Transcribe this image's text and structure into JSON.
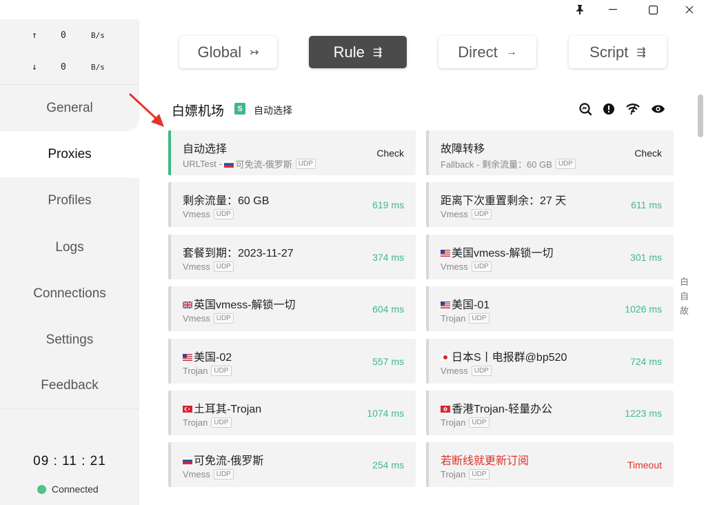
{
  "window": {
    "pin_icon": "pin-icon",
    "min_icon": "minimize-icon",
    "max_icon": "maximize-icon",
    "close_icon": "close-icon"
  },
  "traffic": {
    "up_arrow": "↑",
    "up_value": "0",
    "up_unit": "B/s",
    "down_arrow": "↓",
    "down_value": "0",
    "down_unit": "B/s"
  },
  "nav": [
    {
      "label": "General"
    },
    {
      "label": "Proxies",
      "active": true
    },
    {
      "label": "Profiles"
    },
    {
      "label": "Logs"
    },
    {
      "label": "Connections"
    },
    {
      "label": "Settings"
    },
    {
      "label": "Feedback"
    }
  ],
  "status": {
    "clock": "09 : 11 : 21",
    "connection": "Connected",
    "connection_color": "#4cc48a"
  },
  "modes": [
    {
      "label": "Global",
      "icon": "↣"
    },
    {
      "label": "Rule",
      "icon": "⇶",
      "active": true
    },
    {
      "label": "Direct",
      "icon": "→"
    },
    {
      "label": "Script",
      "icon": "⇶"
    }
  ],
  "group": {
    "title": "白嫖机场",
    "badge": "S",
    "selected": "自动选择"
  },
  "side_hint": [
    "白",
    "自",
    "故"
  ],
  "proxies": [
    {
      "name": "自动选择",
      "type": "URLTest - ",
      "type_tail": "可免流-俄罗斯",
      "tail_flag": "ru",
      "udp": "UDP",
      "value": "Check",
      "kind": "check",
      "selected": true
    },
    {
      "name": "故障转移",
      "type": "Fallback - 剩余流量：60 GB",
      "udp": "UDP",
      "value": "Check",
      "kind": "check"
    },
    {
      "name": "剩余流量：60 GB",
      "type": "Vmess",
      "udp": "UDP",
      "value": "619 ms",
      "kind": "ok"
    },
    {
      "name": "距离下次重置剩余：27 天",
      "type": "Vmess",
      "udp": "UDP",
      "value": "611 ms",
      "kind": "ok"
    },
    {
      "name": "套餐到期：2023-11-27",
      "type": "Vmess",
      "udp": "UDP",
      "value": "374 ms",
      "kind": "ok"
    },
    {
      "name": "美国vmess-解锁一切",
      "flag": "us",
      "type": "Vmess",
      "udp": "UDP",
      "value": "301 ms",
      "kind": "ok"
    },
    {
      "name": "英国vmess-解锁一切",
      "flag": "gb",
      "type": "Vmess",
      "udp": "UDP",
      "value": "604 ms",
      "kind": "ok"
    },
    {
      "name": "美国-01",
      "flag": "us",
      "type": "Trojan",
      "udp": "UDP",
      "value": "1026 ms",
      "kind": "ok"
    },
    {
      "name": "美国-02",
      "flag": "us",
      "type": "Trojan",
      "udp": "UDP",
      "value": "557 ms",
      "kind": "ok"
    },
    {
      "name": "日本S丨电报群@bp520",
      "flag": "jp",
      "type": "Vmess",
      "udp": "UDP",
      "value": "724 ms",
      "kind": "ok"
    },
    {
      "name": "土耳其-Trojan",
      "flag": "tr",
      "type": "Trojan",
      "udp": "UDP",
      "value": "1074 ms",
      "kind": "ok"
    },
    {
      "name": "香港Trojan-轻量办公",
      "flag": "hk",
      "type": "Trojan",
      "udp": "UDP",
      "value": "1223 ms",
      "kind": "ok"
    },
    {
      "name": "可免流-俄罗斯",
      "flag": "ru",
      "type": "Vmess",
      "udp": "UDP",
      "value": "254 ms",
      "kind": "ok"
    },
    {
      "name": "若断线就更新订阅",
      "type": "Trojan",
      "udp": "UDP",
      "value": "Timeout",
      "kind": "timeout",
      "red": true
    }
  ],
  "colors": {
    "accent": "#3fb985",
    "timeout": "#e0302a",
    "active_mode": "#4b4b4b",
    "annotation_arrow": "#e8332a"
  }
}
